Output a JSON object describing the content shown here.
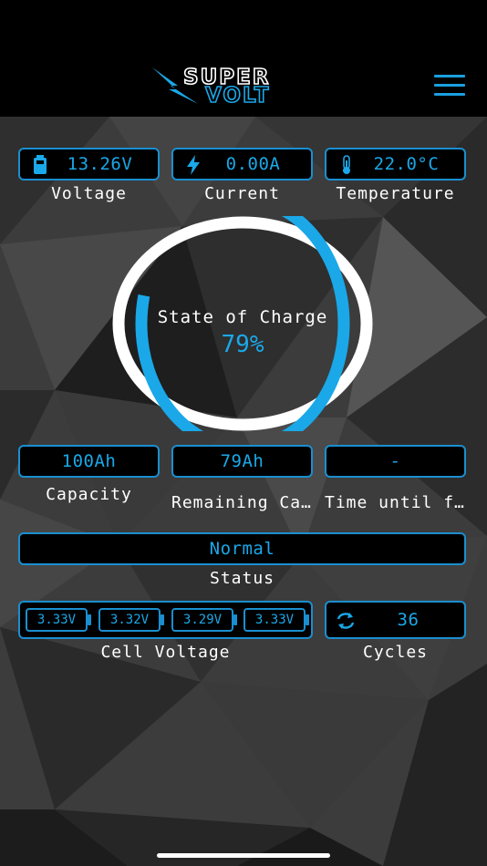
{
  "header": {
    "logo_line1": "SUPER",
    "logo_line2": "VOLT",
    "menu_icon": "hamburger-menu-icon"
  },
  "metrics": {
    "voltage": {
      "value": "13.26V",
      "label": "Voltage",
      "icon": "battery-icon"
    },
    "current": {
      "value": "0.00A",
      "label": "Current",
      "icon": "lightning-bolt-icon"
    },
    "temperature": {
      "value": "22.0°C",
      "label": "Temperature",
      "icon": "thermometer-icon"
    }
  },
  "soc": {
    "title": "State of Charge",
    "value": "79%",
    "fraction": 0.79
  },
  "capacity": {
    "value": "100Ah",
    "label": "Capacity"
  },
  "remaining": {
    "value": "79Ah",
    "label": "Remaining Ca…"
  },
  "time_until": {
    "value": "-",
    "label": "Time until f…"
  },
  "status": {
    "value": "Normal",
    "label": "Status"
  },
  "cells": {
    "values": [
      "3.33V",
      "3.32V",
      "3.29V",
      "3.33V"
    ],
    "label": "Cell Voltage"
  },
  "cycles": {
    "value": "36",
    "label": "Cycles",
    "icon": "refresh-cycle-icon"
  },
  "colors": {
    "accent": "#1aa8e8",
    "border": "#1a8fd0",
    "ring_track": "#ffffff"
  }
}
